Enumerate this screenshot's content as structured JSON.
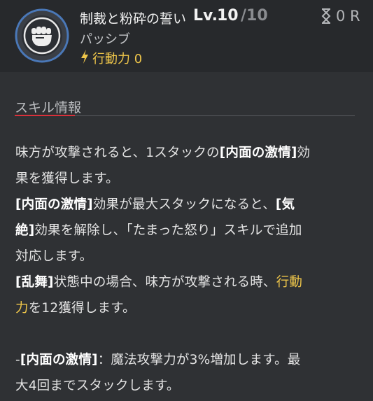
{
  "header": {
    "skill_name": "制裁と粉砕の誓い",
    "level_label": "Lv.",
    "level": "10",
    "level_max": "/10",
    "cooldown": "0 R",
    "skill_type": "パッシブ",
    "action_points": "行動力 0",
    "icon": "fist-icon",
    "colors": {
      "accent_yellow": "#efc64a",
      "ring_blue": "#4a78b8",
      "underline_red": "#d9303a"
    }
  },
  "section": {
    "title": "スキル情報"
  },
  "description": {
    "l1a": "味方が攻撃されると、1スタックの",
    "l1b": "[内面の激情]",
    "l1c": "効",
    "l2": "果を獲得します。",
    "l3a": "[内面の激情]",
    "l3b": "効果が最大スタックになると、",
    "l3c": "[気",
    "l4a": "絶]",
    "l4b": "効果を解除し、「たまった怒り」スキルで追加",
    "l5": "対応します。",
    "l6a": "[乱舞]",
    "l6b": "状態中の場合、味方が攻撃される時、",
    "l6c": "行動",
    "l7a": "力",
    "l7b": "を12獲得します。",
    "l8a": "-",
    "l8b": "[内面の激情]",
    "l8c": "：魔法攻撃力が3%増加します。最",
    "l9": "大4回までスタックします。"
  }
}
